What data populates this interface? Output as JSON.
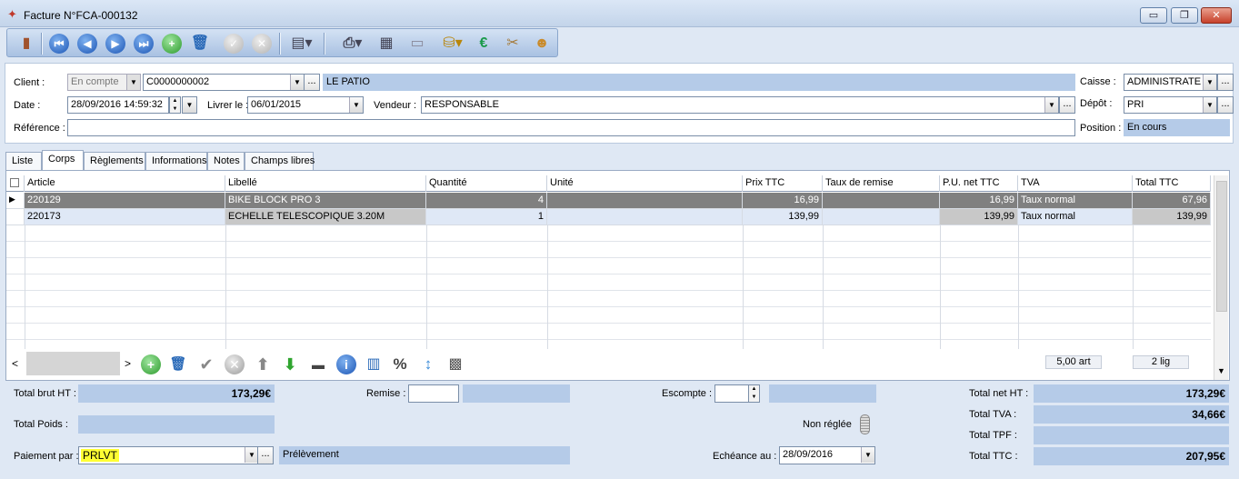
{
  "window": {
    "title": "Facture N°FCA-000132",
    "minimize": "▭",
    "maximize": "❐",
    "close": "✕"
  },
  "form": {
    "client_label": "Client :",
    "client_type": "En compte",
    "client_code": "C0000000002",
    "client_name": "LE PATIO",
    "caisse_label": "Caisse :",
    "caisse_value": "ADMINISTRATE",
    "date_label": "Date :",
    "date_value": "28/09/2016 14:59:32",
    "livrer_label": "Livrer le :",
    "livrer_value": "06/01/2015",
    "vendeur_label": "Vendeur :",
    "vendeur_value": "RESPONSABLE",
    "depot_label": "Dépôt :",
    "depot_value": "PRI",
    "reference_label": "Référence :",
    "reference_value": "",
    "position_label": "Position :",
    "position_value": "En cours",
    "ellipsis": "..."
  },
  "tabs": [
    "Liste",
    "Corps",
    "Règlements",
    "Informations",
    "Notes",
    "Champs libres"
  ],
  "grid": {
    "columns": [
      "Article",
      "Libellé",
      "Quantité",
      "Unité",
      "Prix TTC",
      "Taux de remise",
      "P.U. net TTC",
      "TVA",
      "Total TTC"
    ],
    "rows": [
      [
        "220129",
        "BIKE BLOCK PRO 3",
        "4",
        "",
        "16,99",
        "",
        "16,99",
        "Taux normal",
        "67,96"
      ],
      [
        "220173",
        "ECHELLE TELESCOPIQUE 3.20M",
        "1",
        "",
        "139,99",
        "",
        "139,99",
        "Taux normal",
        "139,99"
      ]
    ],
    "count_articles": "5,00 art",
    "count_lines": "2 lig"
  },
  "totals": {
    "brut_ht_label": "Total brut HT :",
    "brut_ht_value": "173,29€",
    "remise_label": "Remise :",
    "escompte_label": "Escompte :",
    "net_ht_label": "Total net HT :",
    "net_ht_value": "173,29€",
    "poids_label": "Total Poids :",
    "non_reglee_label": "Non réglée",
    "tva_label": "Total TVA :",
    "tva_value": "34,66€",
    "tpf_label": "Total TPF :",
    "tpf_value": "",
    "paiement_label": "Paiement par :",
    "paiement_code": "PRLVT",
    "paiement_name": "Prélèvement",
    "echeance_label": "Echéance au :",
    "echeance_value": "28/09/2016",
    "ttc_label": "Total TTC :",
    "ttc_value": "207,95€"
  },
  "colors": {
    "accent": "#b5cbe8",
    "selected_row": "#808080",
    "alt_row": "#dfe8f6",
    "highlight": "#ffff33"
  }
}
